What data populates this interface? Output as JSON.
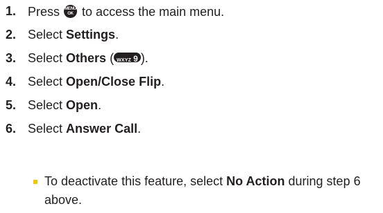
{
  "steps": [
    {
      "num": "1.",
      "pre": "Press",
      "key_top": "MENU",
      "key_bottom": "OK",
      "post": "to access the main menu."
    },
    {
      "num": "2.",
      "pre": "Select",
      "bold": "Settings",
      "post": "."
    },
    {
      "num": "3.",
      "pre": "Select",
      "bold": "Others",
      "open": "(",
      "key_letters": "WXYZ",
      "key_digit": "9",
      "close": ")."
    },
    {
      "num": "4.",
      "pre": "Select",
      "bold": "Open/Close Flip",
      "post": "."
    },
    {
      "num": "5.",
      "pre": "Select",
      "bold": "Open",
      "post": "."
    },
    {
      "num": "6.",
      "pre": "Select",
      "bold": "Answer Call",
      "post": "."
    }
  ],
  "note": {
    "pre": "To deactivate this feature, select",
    "bold": "No Action",
    "post": "during step 6 above."
  },
  "colors": {
    "text": "#231f20",
    "bullet": "#f5c400",
    "key_bg": "#231f20"
  }
}
